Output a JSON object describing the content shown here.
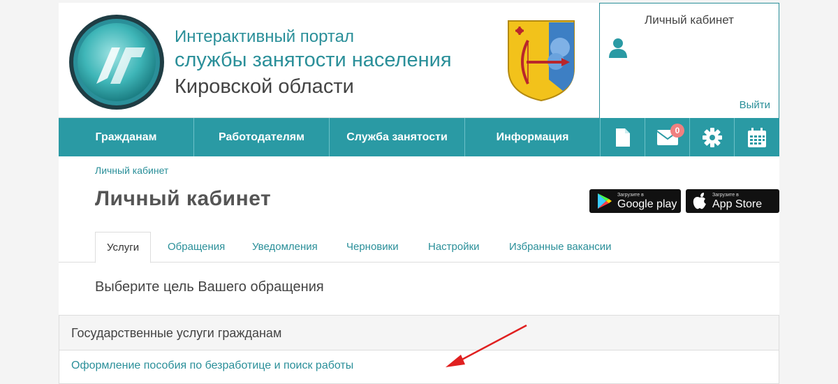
{
  "header": {
    "title_line1": "Интерактивный портал",
    "title_line2": "службы занятости населения",
    "title_line3": "Кировской области"
  },
  "account": {
    "title": "Личный кабинет",
    "logout_label": "Выйти"
  },
  "nav": {
    "items": [
      {
        "label": "Гражданам"
      },
      {
        "label": "Работодателям"
      },
      {
        "label": "Служба занятости"
      },
      {
        "label": "Информация"
      }
    ],
    "icons": [
      "document-icon",
      "mail-icon",
      "gear-icon",
      "calendar-icon"
    ],
    "mail_badge": "0"
  },
  "breadcrumb": "Личный кабинет",
  "page_title": "Личный кабинет",
  "stores": {
    "google_small": "Загрузите в",
    "google_big": "Google play",
    "apple_small": "Загрузите в",
    "apple_big": "App Store"
  },
  "tabs": [
    {
      "label": "Услуги",
      "active": true
    },
    {
      "label": "Обращения"
    },
    {
      "label": "Уведомления"
    },
    {
      "label": "Черновики"
    },
    {
      "label": "Настройки"
    },
    {
      "label": "Избранные вакансии"
    }
  ],
  "subtitle": "Выберите цель Вашего обращения",
  "panel": {
    "heading": "Государственные услуги гражданам",
    "link": "Оформление пособия по безработице и поиск работы"
  },
  "colors": {
    "accent": "#2a9aa4",
    "link": "#2a8f99",
    "badge": "#f08080",
    "annotation_arrow": "#e02020"
  }
}
